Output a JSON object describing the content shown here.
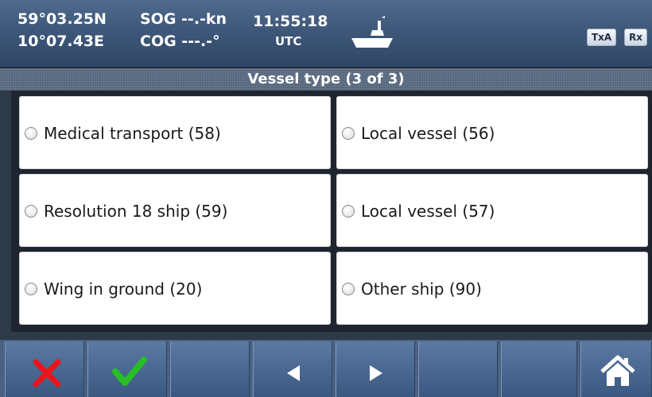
{
  "status": {
    "latitude": "59°03.25N",
    "longitude": "10°07.43E",
    "sog": "SOG --.-kn",
    "cog": "COG ---.-°",
    "time": "11:55:18",
    "time_zone": "UTC",
    "tx_badge": "TxA",
    "rx_badge": "Rx",
    "ship_icon": "ship-icon"
  },
  "dialog": {
    "title": "Vessel type (3 of 3)"
  },
  "options": [
    {
      "label": "Medical transport (58)"
    },
    {
      "label": "Local vessel (56)"
    },
    {
      "label": "Resolution 18 ship (59)"
    },
    {
      "label": "Local vessel (57)"
    },
    {
      "label": "Wing in ground (20)"
    },
    {
      "label": "Other ship (90)"
    }
  ],
  "toolbar": {
    "icons": [
      "close-icon",
      "check-icon",
      "",
      "arrow-left-icon",
      "arrow-right-icon",
      "",
      "",
      "home-icon"
    ]
  },
  "colors": {
    "cancel": "#e8151b",
    "confirm": "#27c024",
    "status_bar": "#3f587a",
    "button": "#4a6891"
  }
}
